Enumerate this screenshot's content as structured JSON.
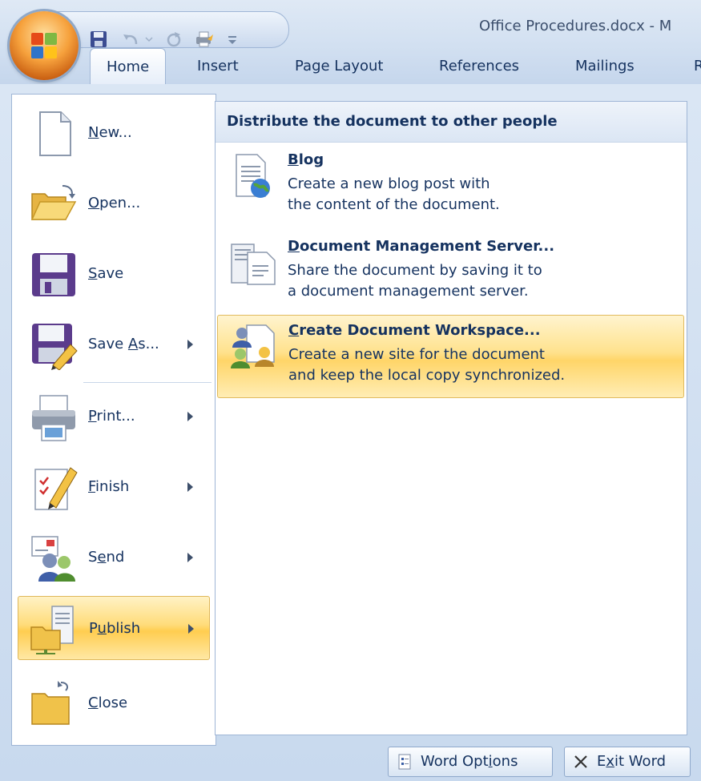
{
  "window": {
    "title": "Office Procedures.docx - M"
  },
  "quick_access": {
    "icons": [
      "save-icon",
      "undo-icon",
      "redo-icon",
      "quick-print-icon",
      "customize-dropdown-icon"
    ]
  },
  "ribbon": {
    "tabs": [
      {
        "label": "Home",
        "active": true
      },
      {
        "label": "Insert"
      },
      {
        "label": "Page Layout"
      },
      {
        "label": "References"
      },
      {
        "label": "Mailings"
      },
      {
        "label": "R"
      }
    ]
  },
  "office_menu": {
    "items": [
      {
        "label": "New...",
        "access_key": "N",
        "icon": "new-document-icon",
        "has_submenu": false
      },
      {
        "label": "Open...",
        "access_key": "O",
        "icon": "open-folder-icon",
        "has_submenu": false
      },
      {
        "label": "Save",
        "access_key": "S",
        "icon": "save-disk-icon",
        "has_submenu": false
      },
      {
        "label": "Save As...",
        "access_key": "A",
        "icon": "save-as-icon",
        "has_submenu": true
      },
      {
        "label": "Print...",
        "access_key": "P",
        "icon": "printer-icon",
        "has_submenu": true
      },
      {
        "label": "Finish",
        "access_key": "F",
        "icon": "finish-pencil-icon",
        "has_submenu": true
      },
      {
        "label": "Send",
        "access_key": "e",
        "icon": "send-people-icon",
        "has_submenu": true
      },
      {
        "label": "Publish",
        "access_key": "u",
        "icon": "publish-server-icon",
        "has_submenu": true,
        "active": true
      },
      {
        "label": "Close",
        "access_key": "C",
        "icon": "close-folder-icon",
        "has_submenu": false
      }
    ]
  },
  "publish_panel": {
    "header": "Distribute the document to other people",
    "items": [
      {
        "title": "Blog",
        "access_key": "B",
        "desc_line1": "Create a new blog post with",
        "desc_line2": "the content of the document.",
        "icon": "blog-globe-icon"
      },
      {
        "title": "Document Management Server...",
        "access_key": "D",
        "desc_line1": "Share the document by saving it to",
        "desc_line2": "a document management server.",
        "icon": "document-server-icon"
      },
      {
        "title": "Create Document Workspace...",
        "access_key": "C",
        "desc_line1": "Create a new site for the document",
        "desc_line2": "and keep the local copy synchronized.",
        "icon": "workspace-people-icon",
        "active": true
      }
    ]
  },
  "footer": {
    "word_options_label": "Word Options",
    "exit_word_label": "Exit Word"
  }
}
